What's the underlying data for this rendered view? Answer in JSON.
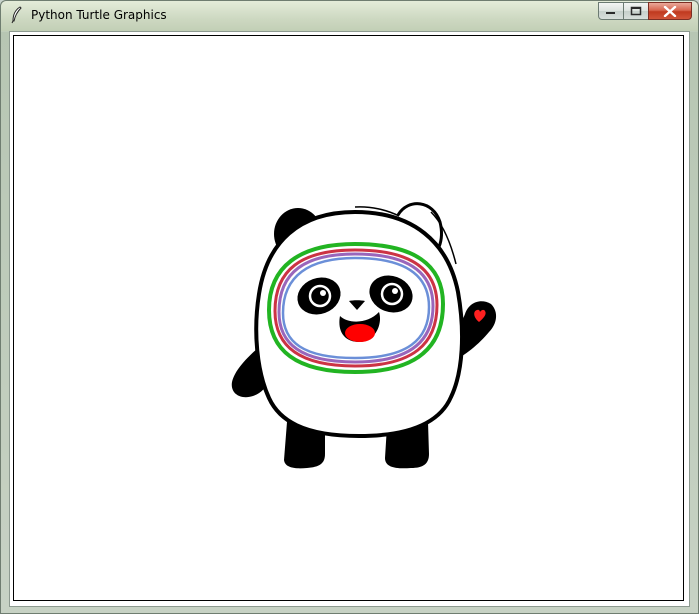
{
  "window": {
    "title": "Python Turtle Graphics",
    "icon": "feather-icon",
    "controls": {
      "minimize": "minimize-icon",
      "maximize": "maximize-icon",
      "close": "close-icon"
    }
  },
  "canvas": {
    "background": "#ffffff",
    "figure": "panda drawing",
    "colors": {
      "fur": "#000000",
      "outline_green": "#22b422",
      "outline_red": "#cc3344",
      "outline_purple": "#9966bb",
      "outline_blue": "#6b8fd8",
      "mouth": "#ff0000",
      "heart": "#ff0000"
    }
  }
}
